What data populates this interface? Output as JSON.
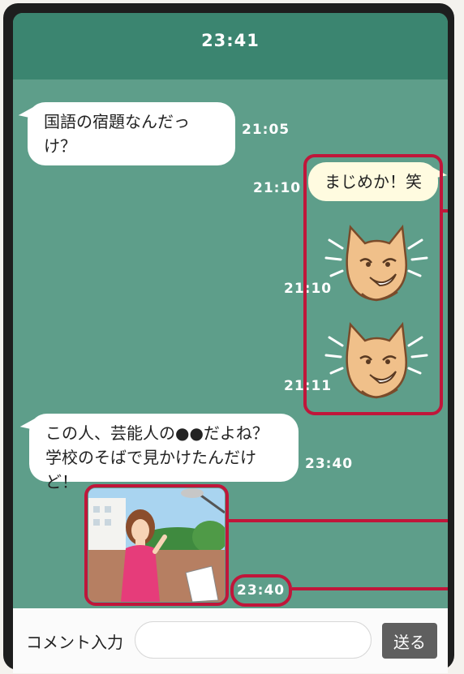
{
  "header": {
    "clock": "23:41"
  },
  "messages": [
    {
      "side": "left",
      "type": "text",
      "text": "国語の宿題なんだっけ？",
      "time": "21:05"
    },
    {
      "side": "right",
      "type": "text",
      "text": "まじめか！笑",
      "time": "21:10"
    },
    {
      "side": "right",
      "type": "sticker",
      "sticker": "cat-grin-sticker",
      "time": "21:10"
    },
    {
      "side": "right",
      "type": "sticker",
      "sticker": "cat-grin-sticker",
      "time": "21:11"
    },
    {
      "side": "left",
      "type": "text",
      "lines": [
        "この人、芸能人の●●だよね？",
        "学校のそばで見かけたんだけど！"
      ],
      "time": "23:40"
    },
    {
      "side": "left",
      "type": "photo",
      "photo": "woman-in-pink-dress-photo",
      "time": "23:40"
    }
  ],
  "input_bar": {
    "label": "コメント入力",
    "placeholder": "",
    "send_label": "送る"
  },
  "colors": {
    "header": "#3b8570",
    "chat_background": "#5e9e8a",
    "highlight": "#c0163a",
    "own_bubble": "#fffbe0",
    "send_button": "#5f5f5f"
  }
}
